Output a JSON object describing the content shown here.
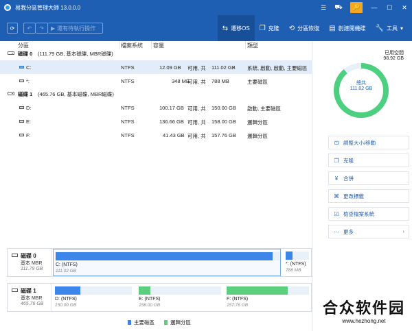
{
  "app": {
    "title": "易我分區管理大師 13.0.0.0"
  },
  "titlebar": {
    "list_icon": "list-icon",
    "cart_icon": "cart-icon",
    "key_icon": "key-icon"
  },
  "toolbar": {
    "pending_label": "還有待執行操作",
    "tools": [
      {
        "label": "遷移OS",
        "icon": "migrate-icon",
        "active": true
      },
      {
        "label": "克隆",
        "icon": "clone-icon"
      },
      {
        "label": "分區恢復",
        "icon": "recovery-icon"
      },
      {
        "label": "創建開機碟",
        "icon": "bootdisk-icon"
      },
      {
        "label": "工具",
        "icon": "tools-icon"
      }
    ]
  },
  "columns": {
    "partition": "分區",
    "filesystem": "檔案系統",
    "capacity": "容量",
    "type": "類型"
  },
  "disks": [
    {
      "label": "磁碟 0",
      "info": "(111.79 GB, 基本磁碟, MBR磁碟)",
      "partitions": [
        {
          "name": "C:",
          "fs": "NTFS",
          "used": "12.09 GB",
          "free_label": "可用, 共",
          "total": "111.02 GB",
          "type": "系統, 啟動, 啟動, 主要磁區"
        },
        {
          "name": "*:",
          "fs": "NTFS",
          "used": "348 MB",
          "free_label": "可用, 共",
          "total": "788 MB",
          "type": "主要磁區"
        }
      ]
    },
    {
      "label": "磁碟 1",
      "info": "(465.76 GB, 基本磁碟, MBR磁碟)",
      "partitions": [
        {
          "name": "D:",
          "fs": "NTFS",
          "used": "100.17 GB",
          "free_label": "可用, 共",
          "total": "150.00 GB",
          "type": "啟動, 主要磁區"
        },
        {
          "name": "E:",
          "fs": "NTFS",
          "used": "136.66 GB",
          "free_label": "可用, 共",
          "total": "158.00 GB",
          "type": "邏輯分區"
        },
        {
          "name": "F:",
          "fs": "NTFS",
          "used": "41.43 GB",
          "free_label": "可用, 共",
          "total": "157.76 GB",
          "type": "邏輯分區"
        }
      ]
    }
  ],
  "diskmap": [
    {
      "name": "磁碟 0",
      "kind": "基本 MBR",
      "size": "111.79 GB",
      "segments": [
        {
          "label": "C: (NTFS)",
          "size": "111.02 GB",
          "fill": 0.97,
          "color": "#3b86e8"
        },
        {
          "label": "*: (NTFS)",
          "size": "788 MB",
          "fill": 0.3,
          "color": "#3b86e8"
        }
      ]
    },
    {
      "name": "磁碟 1",
      "kind": "基本 MBR",
      "size": "465.76 GB",
      "segments": [
        {
          "label": "D: (NTFS)",
          "size": "150.00 GB",
          "fill": 0.33,
          "color": "#3b86e8"
        },
        {
          "label": "E: (NTFS)",
          "size": "158.00 GB",
          "fill": 0.14,
          "color": "#5ccf7f"
        },
        {
          "label": "F: (NTFS)",
          "size": "157.76 GB",
          "fill": 0.74,
          "color": "#5ccf7f"
        }
      ]
    }
  ],
  "legend": {
    "primary": "主要磁區",
    "logical": "邏輯分區",
    "primary_color": "#3b86e8",
    "logical_color": "#5ccf7f"
  },
  "side": {
    "used_label": "已用空間",
    "used_value": "98.92 GB",
    "center_label": "總共",
    "center_value": "111.02 GB",
    "used_fraction": 0.89,
    "actions": [
      {
        "label": "調整大小/移動",
        "icon": "resize-icon"
      },
      {
        "label": "克隆",
        "icon": "clone-icon"
      },
      {
        "label": "合併",
        "icon": "merge-icon"
      },
      {
        "label": "更改標籤",
        "icon": "tag-icon"
      },
      {
        "label": "檢查檔案系統",
        "icon": "check-icon"
      },
      {
        "label": "更多",
        "icon": "more-icon"
      }
    ]
  },
  "watermark": {
    "text": "合众软件园",
    "url": "www.hezhong.net"
  }
}
